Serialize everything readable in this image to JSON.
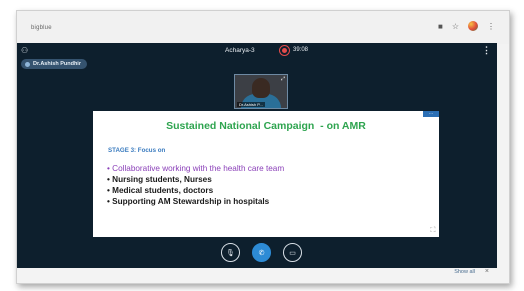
{
  "browser": {
    "url": "bigblue",
    "icons": [
      "camera-icon",
      "star-icon",
      "extension-icon",
      "menu-icon"
    ],
    "icon_glyphs": {
      "camera": "■",
      "star": "☆",
      "menu": "⋮"
    }
  },
  "meeting": {
    "room_name": "Acharya-3",
    "timer": "39:08",
    "presenter_name": "Dr.Ashish Pundhir",
    "video_tile_name": "Dr.Ashish P...",
    "menu_glyph": "⋮",
    "people_glyph": "⚇",
    "colors": {
      "background": "#0d1f2d",
      "recording": "#e34b4b",
      "active_control": "#2d8bd5"
    }
  },
  "slide": {
    "title": "Sustained National Campaign  - on AMR",
    "stage": "STAGE 3: Focus on",
    "bullets": [
      "Collaborative working with the health care team",
      "Nursing students, Nurses",
      "Medical students, doctors",
      "Supporting AM Stewardship in hospitals"
    ],
    "colors": {
      "title": "#2ea44f",
      "stage": "#3a7bbf",
      "first_bullet": "#8a3fb8"
    }
  },
  "controls": {
    "mic_glyph": "🎙",
    "phone_glyph": "✆",
    "screen_glyph": "▭"
  },
  "footer": {
    "show_all": "Show all",
    "close_glyph": "×"
  }
}
